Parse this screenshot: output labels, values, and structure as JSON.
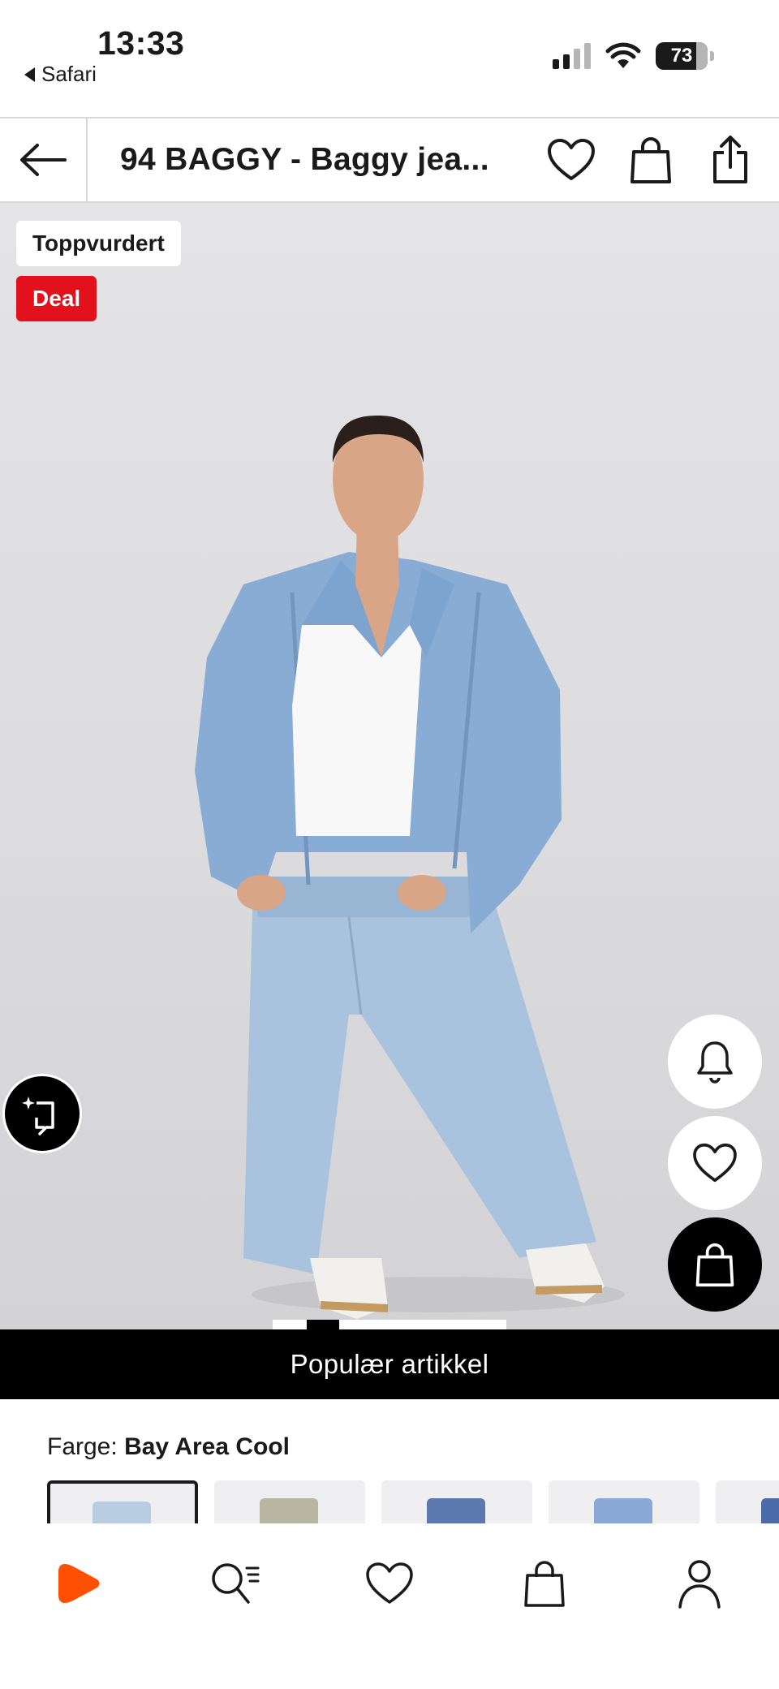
{
  "status_bar": {
    "time": "13:33",
    "back_app": "Safari",
    "battery": "73",
    "icons": [
      "signal-icon",
      "wifi-icon",
      "battery-icon"
    ]
  },
  "header": {
    "title": "94 BAGGY - Baggy jea...",
    "icons": [
      "back-arrow-icon",
      "heart-icon",
      "shopping-bag-icon",
      "share-icon"
    ]
  },
  "product_image": {
    "badges": {
      "top_rated": "Toppvurdert",
      "deal": "Deal"
    },
    "floating_icons": [
      "ai-search-icon",
      "bell-icon",
      "heart-icon",
      "shopping-bag-icon"
    ],
    "pager_active_index": 1
  },
  "popular_banner": "Populær artikkel",
  "color_selector": {
    "label": "Farge:",
    "selected_value": "Bay Area Cool",
    "swatch_colors": [
      "#b9cde2",
      "#b8b6a2",
      "#5b79ae",
      "#8aa8d6",
      "#4a6aa8"
    ],
    "selected_index": 0
  },
  "bottom_nav": {
    "items": [
      "home-logo-icon",
      "search-icon",
      "wishlist-icon",
      "bag-icon",
      "profile-icon"
    ]
  },
  "colors": {
    "deal_red": "#e3111b",
    "brand_orange": "#ff4f00",
    "black": "#000000"
  }
}
